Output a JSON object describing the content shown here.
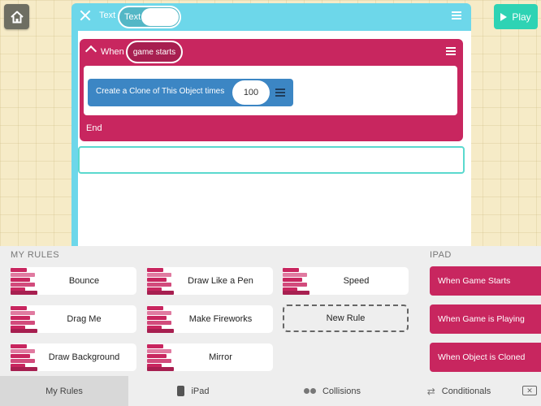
{
  "toolbar": {
    "home_icon": "house-icon",
    "play_label": "Play"
  },
  "editor": {
    "name_label": "Text",
    "name_value": "Text",
    "rule": {
      "when_label": "When",
      "trigger": "game starts",
      "block_label": "Create a Clone of This Object times",
      "block_value": "100",
      "end_label": "End"
    }
  },
  "tray": {
    "my_rules_title": "MY RULES",
    "ipad_title": "IPAD",
    "my_rules": [
      {
        "label": "Bounce"
      },
      {
        "label": "Draw Like a Pen"
      },
      {
        "label": "Speed"
      },
      {
        "label": "Drag Me"
      },
      {
        "label": "Make Fireworks"
      },
      {
        "label": "Draw Background"
      },
      {
        "label": "Mirror"
      }
    ],
    "new_rule_label": "New Rule",
    "ipad_rules": [
      {
        "label": "When Game Starts"
      },
      {
        "label": "When Game is Playing"
      },
      {
        "label": "When Object is Cloned"
      }
    ]
  },
  "tabs": [
    {
      "label": "My Rules"
    },
    {
      "label": "iPad"
    },
    {
      "label": "Collisions"
    },
    {
      "label": "Conditionals"
    }
  ],
  "colors": {
    "rule_magenta": "#c8265f",
    "clone_blue": "#3c86c4",
    "panel_cyan": "#6dd7ea",
    "play_green": "#2ed3b4"
  }
}
